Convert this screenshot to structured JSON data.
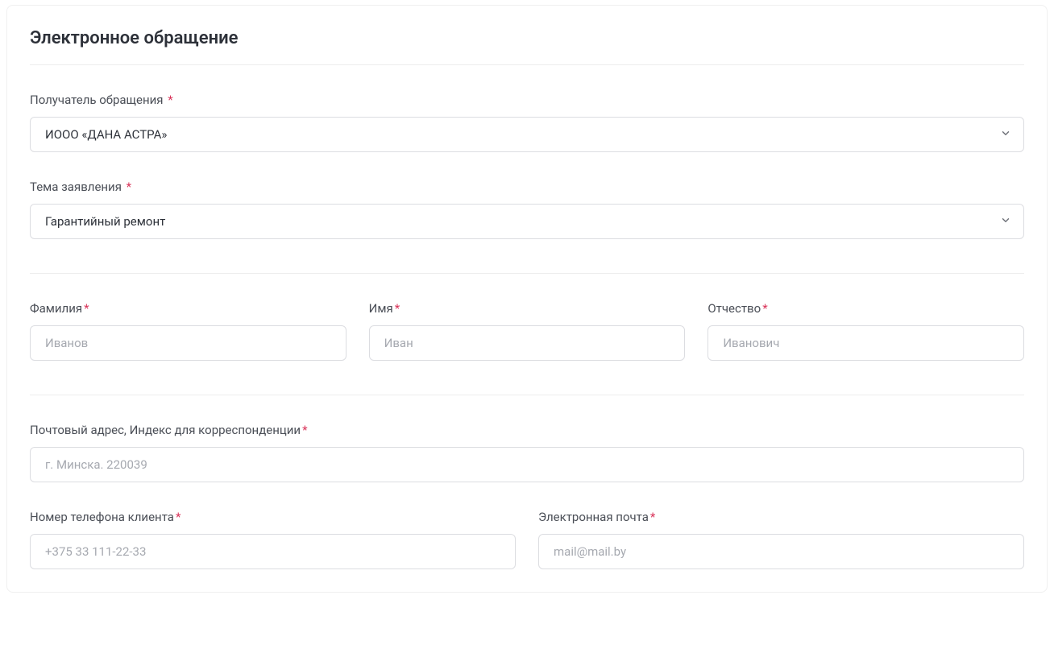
{
  "page": {
    "title": "Электронное обращение"
  },
  "recipient": {
    "label": "Получатель обращения",
    "required_marker": " *",
    "value": "ИООО «ДАНА АСТРА»"
  },
  "subject": {
    "label": "Тема заявления",
    "required_marker": " *",
    "value": "Гарантийный ремонт"
  },
  "last_name": {
    "label": "Фамилия",
    "required_marker": "*",
    "placeholder": "Иванов"
  },
  "first_name": {
    "label": "Имя",
    "required_marker": "*",
    "placeholder": "Иван"
  },
  "patronymic": {
    "label": "Отчество",
    "required_marker": "*",
    "placeholder": "Иванович"
  },
  "postal": {
    "label": "Почтовый адрес, Индекс для корреспонденции",
    "required_marker": "*",
    "placeholder": "г. Минска. 220039"
  },
  "phone": {
    "label": "Номер телефона клиента",
    "required_marker": "*",
    "placeholder": "+375 33 111-22-33"
  },
  "email": {
    "label": "Электронная почта",
    "required_marker": "*",
    "placeholder": "mail@mail.by"
  }
}
